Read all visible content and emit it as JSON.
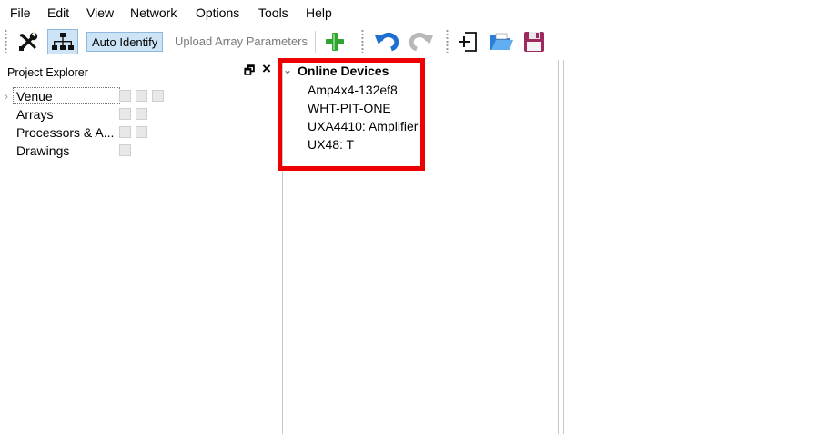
{
  "menu": [
    "File",
    "Edit",
    "View",
    "Network",
    "Options",
    "Tools",
    "Help"
  ],
  "toolbar": {
    "settings_icon": "wrench-screwdriver-icon",
    "network_icon": "network-tree-icon",
    "auto_identify": "Auto Identify",
    "upload_array_parameters": "Upload Array Parameters",
    "add_icon": "green-plus-icon",
    "undo_icon": "undo-icon",
    "redo_icon": "redo-icon",
    "new_icon": "new-document-icon",
    "open_icon": "open-folder-icon",
    "save_icon": "save-disk-icon"
  },
  "project_explorer": {
    "title": "Project Explorer",
    "float_button": "🗗",
    "close_button": "×",
    "items": [
      {
        "label": "Venue",
        "icons": [
          "add-icon",
          "edit-icon",
          "save-icon"
        ]
      },
      {
        "label": "Arrays",
        "icons": [
          "add-icon",
          "edit-icon"
        ]
      },
      {
        "label": "Processors & A...",
        "icons": [
          "add-icon",
          "edit-icon"
        ]
      },
      {
        "label": "Drawings",
        "icons": [
          "add-icon"
        ]
      }
    ]
  },
  "online_devices": {
    "title": "Online Devices",
    "items": [
      "Amp4x4-132ef8",
      "WHT-PIT-ONE",
      "UXA4410: Amplifier",
      "UX48: T"
    ]
  },
  "colors": {
    "highlight": "#ee0000",
    "selected_bg": "#cde4f7"
  }
}
